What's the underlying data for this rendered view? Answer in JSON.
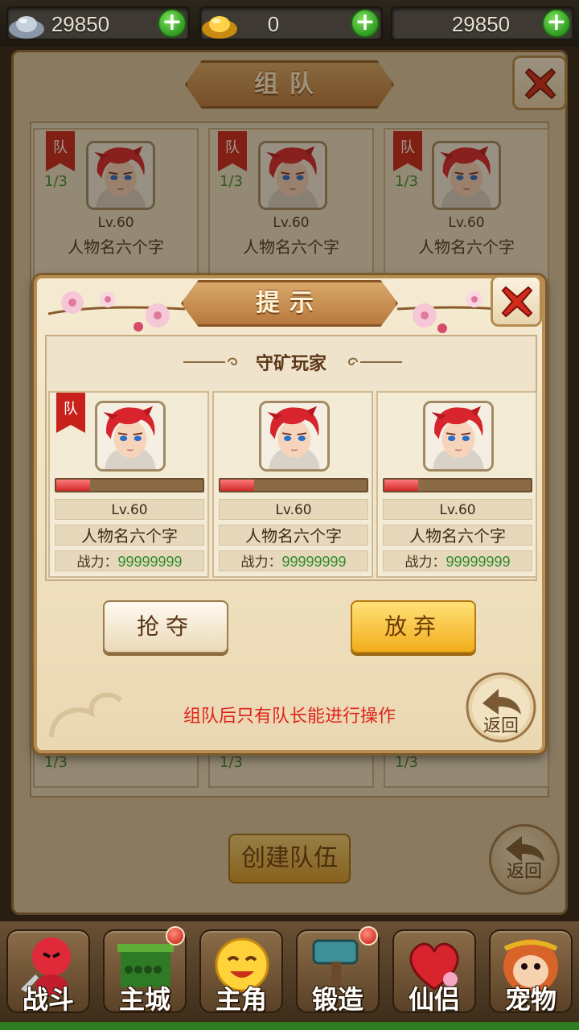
{
  "currency": [
    {
      "icon": "silver-ingot-icon",
      "value": "29850"
    },
    {
      "icon": "gold-ingot-icon",
      "value": "0"
    },
    {
      "icon": "",
      "value": "29850"
    }
  ],
  "plus_label": "+",
  "background_window": {
    "title": "组队",
    "cards": [
      {
        "flag": "队",
        "count": "1/3",
        "level": "Lv.60",
        "name": "人物名六个字"
      },
      {
        "flag": "队",
        "count": "1/3",
        "level": "Lv.60",
        "name": "人物名六个字"
      },
      {
        "flag": "队",
        "count": "1/3",
        "level": "Lv.60",
        "name": "人物名六个字"
      }
    ],
    "lower_counts": [
      "1/3",
      "1/3",
      "1/3"
    ],
    "create_button": "创建队伍",
    "back_button": "返回"
  },
  "dialog": {
    "title": "提示",
    "subtitle": "守矿玩家",
    "players": [
      {
        "flag": "队",
        "hp_fraction": 0.23,
        "level": "Lv.60",
        "name": "人物名六个字",
        "power_label": "战力：",
        "power": "99999999"
      },
      {
        "hp_fraction": 0.23,
        "level": "Lv.60",
        "name": "人物名六个字",
        "power_label": "战力：",
        "power": "99999999"
      },
      {
        "hp_fraction": 0.23,
        "level": "Lv.60",
        "name": "人物名六个字",
        "power_label": "战力：",
        "power": "99999999"
      }
    ],
    "grab_button": "抢夺",
    "abandon_button": "放弃",
    "notice": "组队后只有队长能进行操作",
    "back_button": "返回"
  },
  "bottom_nav": [
    {
      "label": "战斗",
      "icon": "battle-icon",
      "badge": false
    },
    {
      "label": "主城",
      "icon": "main-city-icon",
      "badge": true
    },
    {
      "label": "主角",
      "icon": "hero-icon",
      "badge": false
    },
    {
      "label": "锻造",
      "icon": "forge-hammer-icon",
      "badge": true
    },
    {
      "label": "仙侣",
      "icon": "heart-icon",
      "badge": false
    },
    {
      "label": "宠物",
      "icon": "monkey-pet-icon",
      "badge": false
    }
  ],
  "colors": {
    "accent_red": "#e0231b",
    "power_green": "#2f8a2d",
    "gold_button": "#f2ad1b"
  }
}
